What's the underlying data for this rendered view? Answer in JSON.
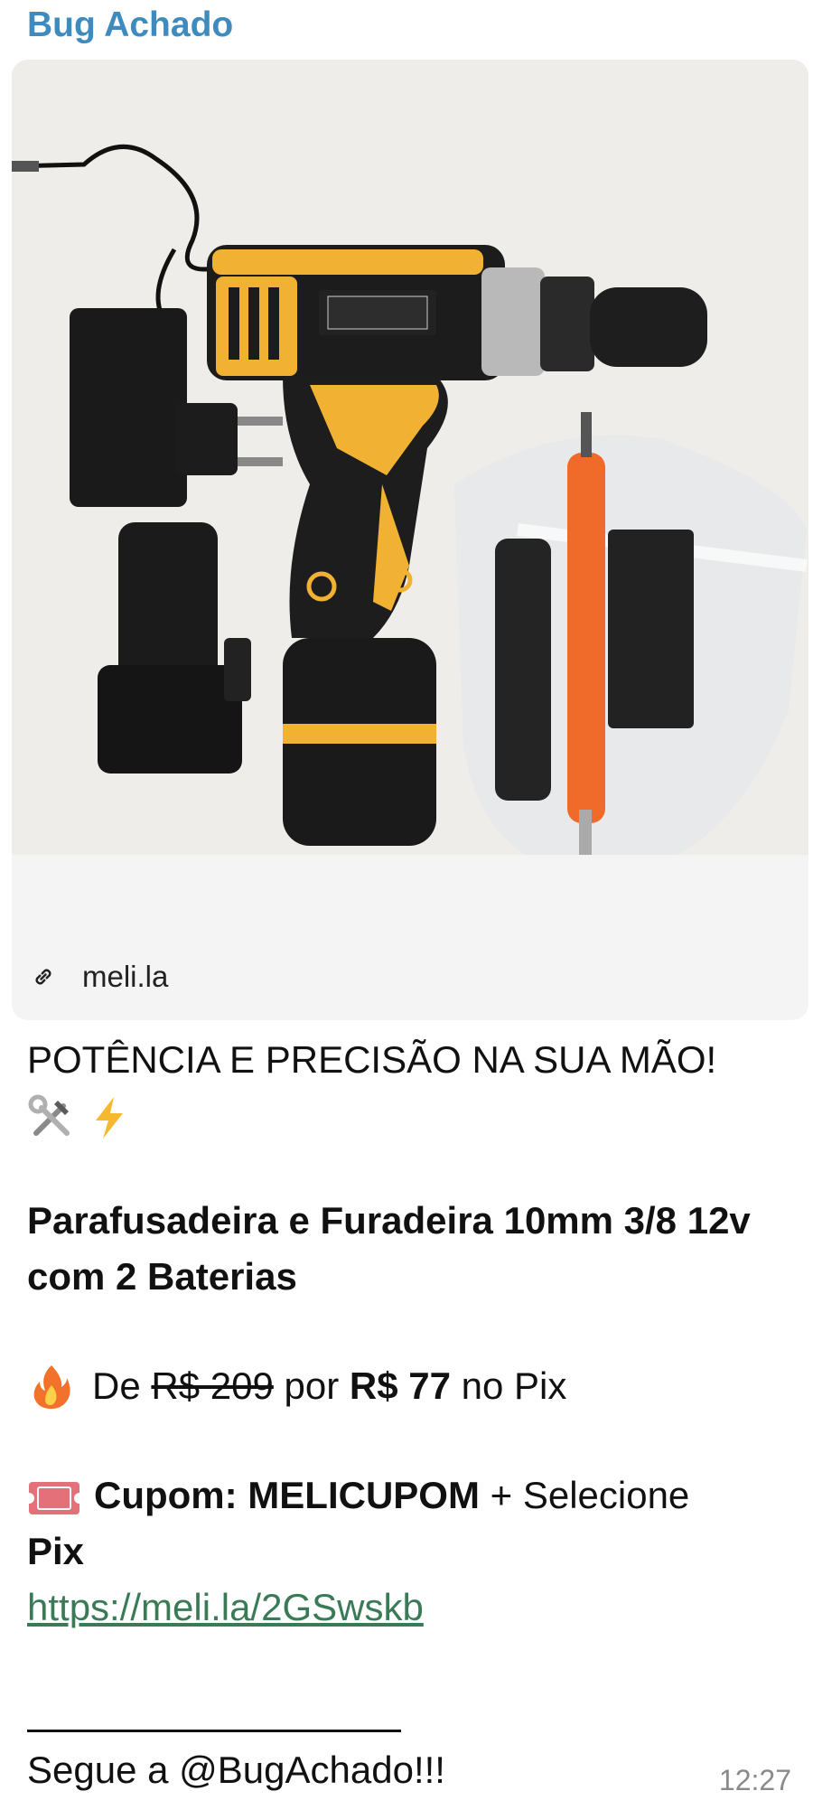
{
  "message": {
    "sender": "Bug Achado",
    "link_preview": {
      "domain": "meli.la",
      "image_description_icon": "product-photo"
    },
    "headline": "POTÊNCIA E PRECISÃO NA SUA MÃO!",
    "headline_emojis": [
      "hammer-and-wrench-emoji",
      "high-voltage-emoji"
    ],
    "product_title": "Parafusadeira e Furadeira 10mm 3/8 12v com 2 Baterias",
    "price": {
      "emoji": "fire-emoji",
      "from_label": "De",
      "old_price": "R$ 209",
      "by_label": "por",
      "new_price": "R$ 77",
      "method": "no Pix"
    },
    "coupon": {
      "emoji": "admission-ticket-emoji",
      "label": "Cupom: MELICUPOM",
      "plus": "+ Selecione",
      "pix": "Pix"
    },
    "url": "https://meli.la/2GSwskb",
    "follow": "Segue a @BugAchado!!!",
    "time": "12:27"
  },
  "colors": {
    "sender": "#3f8bbd",
    "link": "#3b7a57",
    "time": "#8a8a8a"
  }
}
